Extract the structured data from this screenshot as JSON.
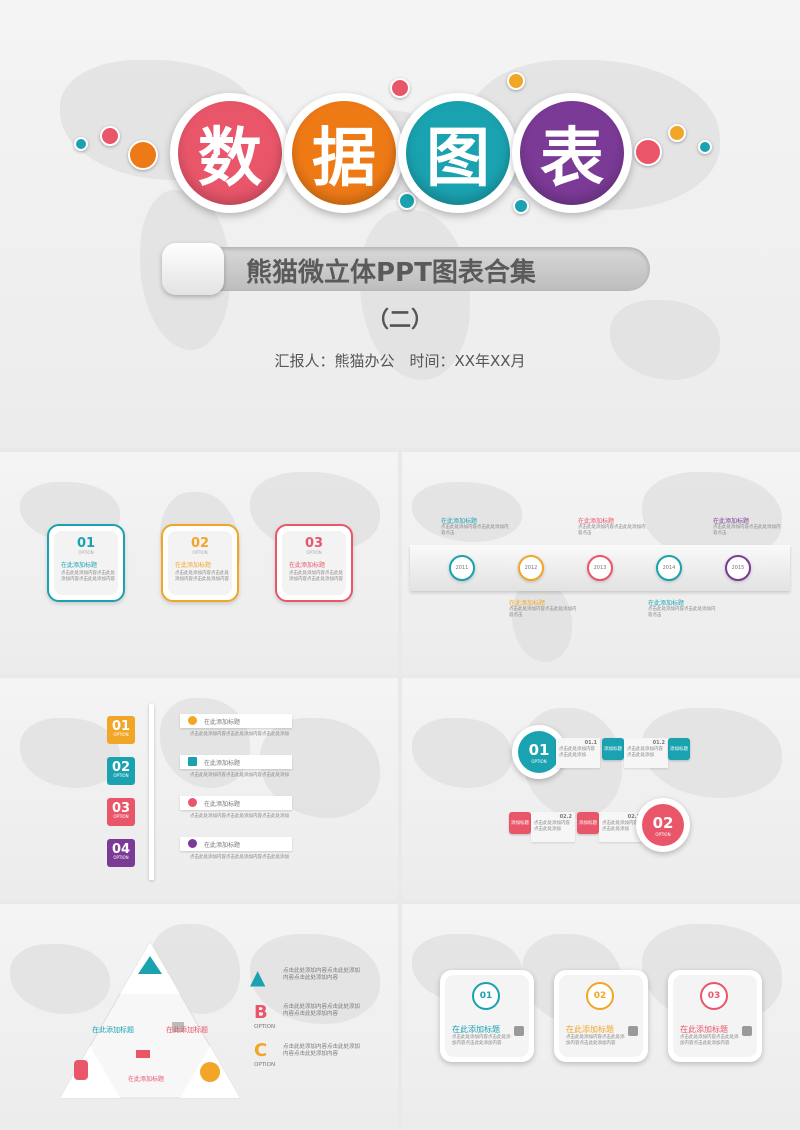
{
  "cover": {
    "title_chars": [
      "数",
      "据",
      "图",
      "表"
    ],
    "title_colors": [
      "#e9566a",
      "#ee7a16",
      "#1aa2b0",
      "#7b3a96"
    ],
    "subtitle": "熊猫微立体PPT图表合集",
    "part": "（二）",
    "meta": "汇报人：熊猫办公　时间：XX年XX月"
  },
  "slide2": {
    "cards": [
      {
        "num": "01",
        "opt": "OPTION",
        "title": "在此添加标题",
        "desc": "点击此处添加内容点击此处添加内容点击此处添加内容",
        "color": "#1aa2b0"
      },
      {
        "num": "02",
        "opt": "OPTION",
        "title": "在此添加标题",
        "desc": "点击此处添加内容点击此处添加内容点击此处添加内容",
        "color": "#f2a627"
      },
      {
        "num": "03",
        "opt": "OPTION",
        "title": "在此添加标题",
        "desc": "点击此处添加内容点击此处添加内容点击此处添加内容",
        "color": "#e9566a"
      }
    ]
  },
  "slide3": {
    "years": [
      {
        "year": "2011",
        "color": "#1aa2b0"
      },
      {
        "year": "2012",
        "color": "#f2a627"
      },
      {
        "year": "2013",
        "color": "#e9566a"
      },
      {
        "year": "2014",
        "color": "#1aa2b0"
      },
      {
        "year": "2015",
        "color": "#7b3a96"
      }
    ],
    "notes": [
      {
        "title": "在此添加标题",
        "desc": "点击此处添加内容点击此处添加内容点击",
        "color": "#1aa2b0"
      },
      {
        "title": "在此添加标题",
        "desc": "点击此处添加内容点击此处添加内容点击",
        "color": "#e9566a"
      },
      {
        "title": "在此添加标题",
        "desc": "点击此处添加内容点击此处添加内容点击",
        "color": "#7b3a96"
      },
      {
        "title": "在此添加标题",
        "desc": "点击此处添加内容点击此处添加内容点击",
        "color": "#f2a627"
      },
      {
        "title": "在此添加标题",
        "desc": "点击此处添加内容点击此处添加内容点击",
        "color": "#1aa2b0"
      }
    ]
  },
  "slide4": {
    "rows": [
      {
        "num": "01",
        "opt": "OPTION",
        "title": "在此添加标题",
        "desc": "点击此处添加内容点击此处添加内容点击此处添加",
        "color": "#f2a627"
      },
      {
        "num": "02",
        "opt": "OPTION",
        "title": "在此添加标题",
        "desc": "点击此处添加内容点击此处添加内容点击此处添加",
        "color": "#1aa2b0"
      },
      {
        "num": "03",
        "opt": "OPTION",
        "title": "在此添加标题",
        "desc": "点击此处添加内容点击此处添加内容点击此处添加",
        "color": "#e9566a"
      },
      {
        "num": "04",
        "opt": "OPTION",
        "title": "在此添加标题",
        "desc": "点击此处添加内容点击此处添加内容点击此处添加",
        "color": "#7b3a96"
      }
    ]
  },
  "slide5": {
    "top": {
      "num": "01",
      "opt": "OPTION",
      "color": "#1aa2b0"
    },
    "bottom": {
      "num": "02",
      "opt": "OPTION",
      "color": "#e9566a"
    },
    "items": [
      {
        "code": "01.1",
        "desc": "点击此处添加内容点击此处添加",
        "label": "添加标题"
      },
      {
        "code": "01.2",
        "desc": "点击此处添加内容点击此处添加",
        "label": "添加标题"
      },
      {
        "code": "02.2",
        "desc": "点击此处添加内容点击此处添加",
        "label": "添加标题"
      },
      {
        "code": "02.1",
        "desc": "点击此处添加内容点击此处添加",
        "label": "添加标题"
      }
    ]
  },
  "slide6": {
    "labels": [
      "在此添加标题",
      "在此添加标题",
      "在此添加标题"
    ],
    "items": [
      {
        "letter": "▲",
        "opt": "",
        "desc": "点击此处添加内容点击此处添加内容点击此处添加内容",
        "color": "#1aa2b0"
      },
      {
        "letter": "B",
        "opt": "OPTION",
        "desc": "点击此处添加内容点击此处添加内容点击此处添加内容",
        "color": "#e9566a"
      },
      {
        "letter": "C",
        "opt": "OPTION",
        "desc": "点击此处添加内容点击此处添加内容点击此处添加内容",
        "color": "#f2a627"
      }
    ]
  },
  "slide7": {
    "cards": [
      {
        "num": "01",
        "title": "在此添加标题",
        "desc": "点击此处添加内容点击此处添加内容点击此处添加内容",
        "color": "#1aa2b0"
      },
      {
        "num": "02",
        "title": "在此添加标题",
        "desc": "点击此处添加内容点击此处添加内容点击此处添加内容",
        "color": "#f2a627"
      },
      {
        "num": "03",
        "title": "在此添加标题",
        "desc": "点击此处添加内容点击此处添加内容点击此处添加内容",
        "color": "#e9566a"
      }
    ]
  }
}
